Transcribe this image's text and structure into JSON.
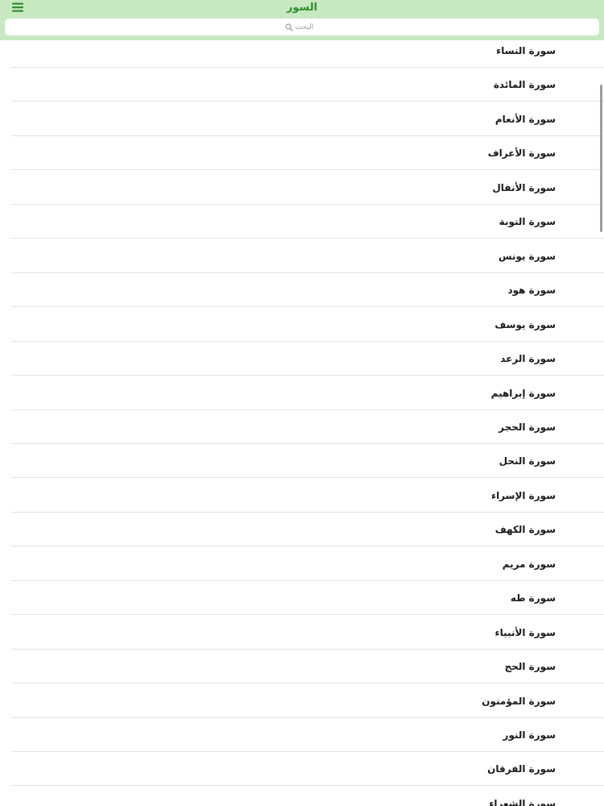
{
  "header": {
    "title": "السور",
    "menu_icon": "hamburger-menu-icon",
    "background_color": "#c7e8c1",
    "title_color": "#2f8f2f"
  },
  "search": {
    "placeholder": "البحث",
    "icon": "search-icon"
  },
  "list": {
    "items": [
      "سورة النساء",
      "سورة المائدة",
      "سورة الأنعام",
      "سورة الأعراف",
      "سورة الأنفال",
      "سورة التوبة",
      "سورة يونس",
      "سورة هود",
      "سورة يوسف",
      "سورة الرعد",
      "سورة إبراهيم",
      "سورة الحجر",
      "سورة النحل",
      "سورة الإسراء",
      "سورة الكهف",
      "سورة مريم",
      "سورة طه",
      "سورة الأنبياء",
      "سورة الحج",
      "سورة المؤمنون",
      "سورة النور",
      "سورة الفرقان",
      "سورة الشعراء"
    ]
  }
}
